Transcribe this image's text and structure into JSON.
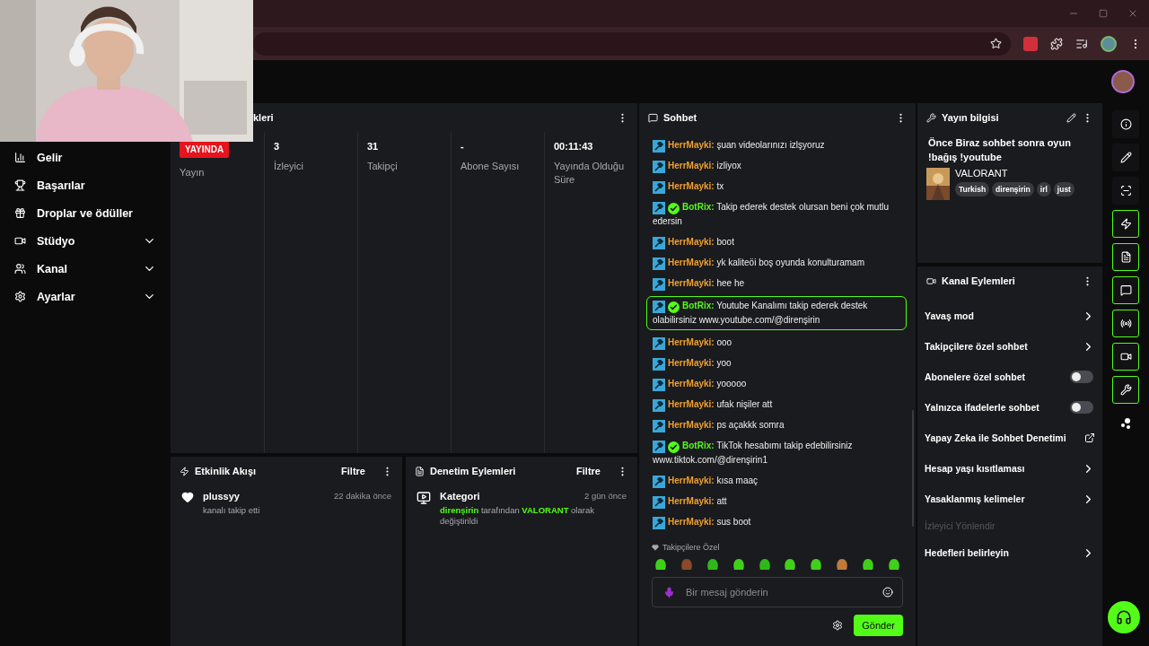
{
  "sidebar": {
    "items": [
      {
        "label": "Gelir",
        "has_submenu": false
      },
      {
        "label": "Başarılar",
        "has_submenu": false
      },
      {
        "label": "Droplar ve ödüller",
        "has_submenu": false
      },
      {
        "label": "Stüdyo",
        "has_submenu": true
      },
      {
        "label": "Kanal",
        "has_submenu": true
      },
      {
        "label": "Ayarlar",
        "has_submenu": true
      }
    ]
  },
  "stats": {
    "title": "kleri",
    "items": [
      {
        "kind": "badge",
        "value": "YAYINDA",
        "label": "Yayın"
      },
      {
        "kind": "number",
        "value": "3",
        "label": "İzleyici"
      },
      {
        "kind": "number",
        "value": "31",
        "label": "Takipçi"
      },
      {
        "kind": "number",
        "value": "-",
        "label": "Abone Sayısı"
      },
      {
        "kind": "number",
        "value": "00:11:43",
        "label": "Yayında Olduğu Süre"
      }
    ]
  },
  "activity": {
    "title": "Etkinlik Akışı",
    "filter": "Filtre",
    "events": [
      {
        "user": "plussyy",
        "action": "kanalı takip etti",
        "time": "22 dakika önce"
      }
    ]
  },
  "moderation": {
    "title": "Denetim Eylemleri",
    "filter": "Filtre",
    "entries": [
      {
        "title": "Kategori",
        "time": "2 gün önce",
        "description": "**direnşirin** tarafından **VALORANT** olarak değiştirildi"
      }
    ]
  },
  "chat": {
    "title": "Sohbet",
    "messages": [
      {
        "kind": "user",
        "user": "HerrMayki:",
        "text": "şuan videolarınızı izlşyoruz",
        "highlighted": false
      },
      {
        "kind": "user",
        "user": "HerrMayki:",
        "text": "izliyox",
        "highlighted": false
      },
      {
        "kind": "user",
        "user": "HerrMayki:",
        "text": "tx",
        "highlighted": false
      },
      {
        "kind": "bot",
        "user": "BotRix:",
        "text": "Takip ederek destek olursan beni çok mutlu edersin",
        "highlighted": false
      },
      {
        "kind": "user",
        "user": "HerrMayki:",
        "text": "boot",
        "highlighted": false
      },
      {
        "kind": "user",
        "user": "HerrMayki:",
        "text": "yk kaliteöi boş oyunda konulturamam",
        "highlighted": false
      },
      {
        "kind": "user",
        "user": "HerrMayki:",
        "text": "hee he",
        "highlighted": false
      },
      {
        "kind": "bot",
        "user": "BotRix:",
        "text": "Youtube Kanalımı takip ederek destek olabilirsiniz www.youtube.com/@direnşirin",
        "highlighted": true
      },
      {
        "kind": "user",
        "user": "HerrMayki:",
        "text": "ooo",
        "highlighted": false
      },
      {
        "kind": "user",
        "user": "HerrMayki:",
        "text": "yoo",
        "highlighted": false
      },
      {
        "kind": "user",
        "user": "HerrMayki:",
        "text": "yooooo",
        "highlighted": false
      },
      {
        "kind": "user",
        "user": "HerrMayki:",
        "text": "ufak nişiler att",
        "highlighted": false
      },
      {
        "kind": "user",
        "user": "HerrMayki:",
        "text": "ps açakkk somra",
        "highlighted": false
      },
      {
        "kind": "bot",
        "user": "BotRix:",
        "text": "TikTok hesabımı takip edebilirsiniz www.tiktok.com/@direnşirin1",
        "highlighted": false
      },
      {
        "kind": "user",
        "user": "HerrMayki:",
        "text": "kısa maaç",
        "highlighted": false
      },
      {
        "kind": "user",
        "user": "HerrMayki:",
        "text": "att",
        "highlighted": false
      },
      {
        "kind": "user",
        "user": "HerrMayki:",
        "text": "sus boot",
        "highlighted": false
      }
    ],
    "emote_label": "Takipçilere Özel",
    "input": {
      "placeholder": "Bir mesaj gönderin"
    },
    "send": "Gönder"
  },
  "stream_info": {
    "title": "Yayın bilgisi",
    "stream_title": "Önce Biraz sohbet sonra oyun !bağış !youtube",
    "category": "VALORANT",
    "tags": [
      "Turkish",
      "direnşirin",
      "irl",
      "just"
    ]
  },
  "channel_actions": {
    "title": "Kanal Eylemleri",
    "items": [
      {
        "kind": "chevron",
        "label": "Yavaş mod",
        "disabled": false
      },
      {
        "kind": "chevron",
        "label": "Takipçilere özel sohbet",
        "disabled": false
      },
      {
        "kind": "toggle",
        "label": "Abonelere özel sohbet",
        "on": false,
        "disabled": false
      },
      {
        "kind": "toggle",
        "label": "Yalnızca ifadelerle sohbet",
        "on": false,
        "disabled": false
      },
      {
        "kind": "external",
        "label": "Yapay Zeka ile Sohbet Denetimi",
        "disabled": false
      },
      {
        "kind": "chevron",
        "label": "Hesap yaşı kısıtlaması",
        "disabled": false
      },
      {
        "kind": "chevron",
        "label": "Yasaklanmış kelimeler",
        "disabled": false
      },
      {
        "kind": "plain",
        "label": "İzleyici Yönlendir",
        "disabled": true
      },
      {
        "kind": "chevron",
        "label": "Hedefleri belirleyin",
        "disabled": false
      }
    ]
  },
  "rail": [
    {
      "active": false
    },
    {
      "active": false
    },
    {
      "active": false
    },
    {
      "active": true
    },
    {
      "active": true
    },
    {
      "active": true
    },
    {
      "active": true
    },
    {
      "active": true
    },
    {
      "active": true
    },
    {
      "active": false
    }
  ]
}
